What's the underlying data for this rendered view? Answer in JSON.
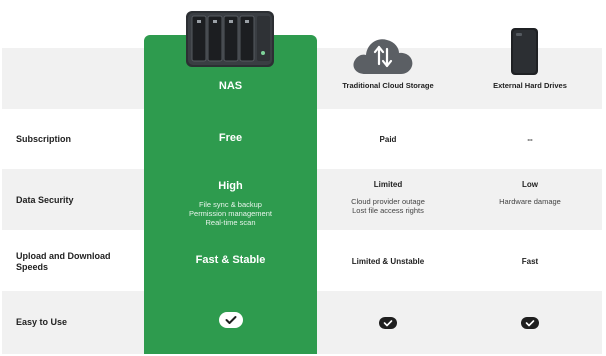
{
  "columns": {
    "nas": "NAS",
    "cloud": "Traditional Cloud Storage",
    "hdd": "External Hard Drives"
  },
  "rows": {
    "subscription": {
      "label": "Subscription",
      "nas": "Free",
      "cloud": "Paid",
      "hdd": "--"
    },
    "security": {
      "label": "Data Security",
      "nas": "High",
      "nas_details": [
        "File sync & backup",
        "Permission management",
        "Real-time scan"
      ],
      "cloud": "Limited",
      "cloud_details": [
        "Cloud provider outage",
        "Lost file access rights"
      ],
      "hdd": "Low",
      "hdd_details": [
        "Hardware damage"
      ]
    },
    "speed": {
      "label_line1": "Upload and Download",
      "label_line2": "Speeds",
      "nas": "Fast & Stable",
      "cloud": "Limited & Unstable",
      "hdd": "Fast"
    },
    "easy": {
      "label": "Easy to Use"
    }
  },
  "colors": {
    "accent": "#2e9b4e",
    "row_shade": "#f1f1f1"
  },
  "icons": {
    "nas": "nas-device-icon",
    "cloud": "cloud-sync-icon",
    "hdd": "external-drive-icon",
    "check": "check-icon"
  }
}
